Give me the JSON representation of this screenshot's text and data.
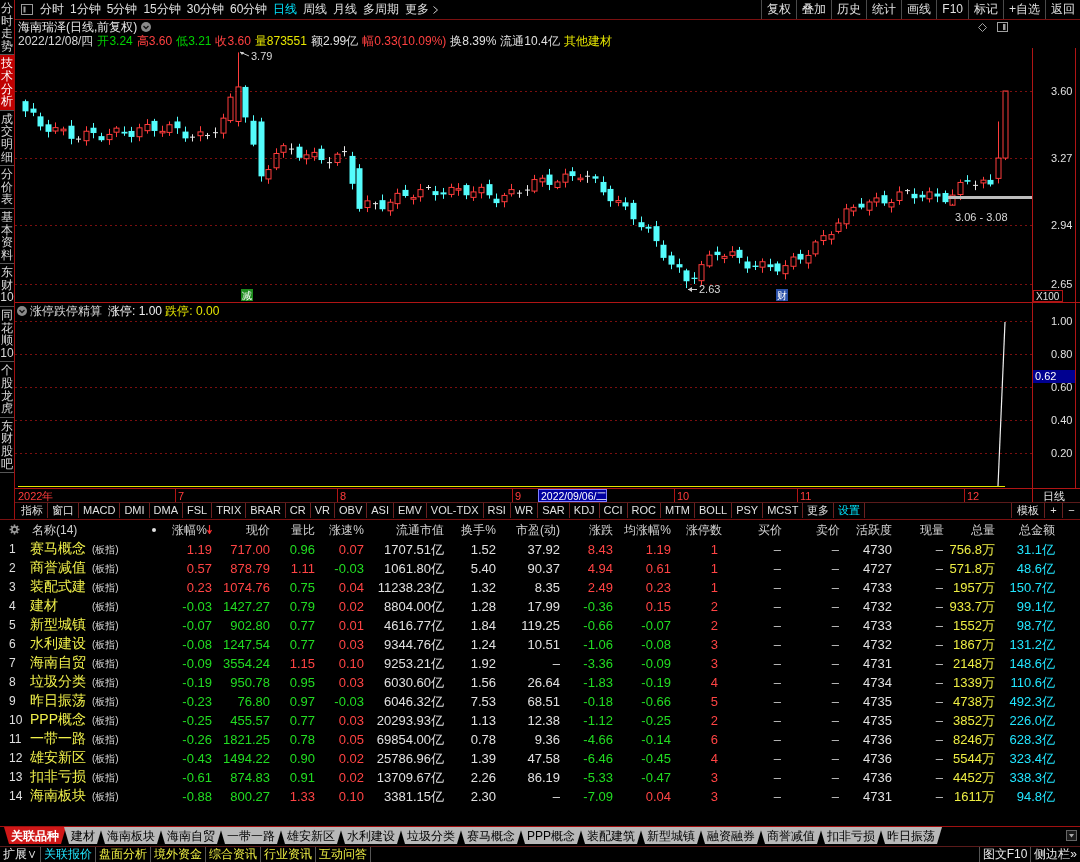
{
  "toolbar": {
    "periods": [
      {
        "label": "分时",
        "kind": "period",
        "selected": false
      },
      {
        "label": "1分钟",
        "kind": "period",
        "selected": false
      },
      {
        "label": "5分钟",
        "kind": "period",
        "selected": false
      },
      {
        "label": "15分钟",
        "kind": "period",
        "selected": false
      },
      {
        "label": "30分钟",
        "kind": "period",
        "selected": false
      },
      {
        "label": "60分钟",
        "kind": "period",
        "selected": false
      },
      {
        "label": "日线",
        "kind": "period",
        "selected": true
      },
      {
        "label": "周线",
        "kind": "period",
        "selected": false
      },
      {
        "label": "月线",
        "kind": "period",
        "selected": false
      },
      {
        "label": "多周期",
        "kind": "period",
        "selected": false
      },
      {
        "label": "更多",
        "kind": "menu",
        "selected": false
      }
    ],
    "actions": [
      "复权",
      "叠加",
      "历史",
      "统计",
      "画线",
      "F10",
      "标记",
      "+自选",
      "返回"
    ]
  },
  "side_tabs": [
    {
      "label": "分时走势",
      "selected": false
    },
    {
      "label": "技术分析",
      "selected": true
    },
    {
      "label": "成交明细",
      "selected": false
    },
    {
      "label": "分价表",
      "selected": false
    },
    {
      "label": "基本资料",
      "selected": false
    },
    {
      "label": "东财10",
      "selected": false
    },
    {
      "label": "同花顺10",
      "selected": false
    },
    {
      "label": "个股龙虎",
      "selected": false
    },
    {
      "label": "东财股吧",
      "selected": false
    }
  ],
  "chart": {
    "title": "海南瑞泽(日线,前复权)",
    "date": "2022/12/08/四",
    "quote": [
      {
        "text": "开3.24",
        "color": "#00d200"
      },
      {
        "text": "高3.60",
        "color": "#ff4040"
      },
      {
        "text": "低3.21",
        "color": "#00d200"
      },
      {
        "text": "收3.60",
        "color": "#ff4040"
      },
      {
        "text": "量873551",
        "color": "#e6e600"
      },
      {
        "text": "额2.99亿",
        "color": "#e0e0e0"
      },
      {
        "text": "幅0.33(10.09%)",
        "color": "#ff4040"
      },
      {
        "text": "换8.39%",
        "color": "#e0e0e0"
      },
      {
        "text": "流通10.4亿",
        "color": "#e0e0e0"
      },
      {
        "text": "其他建材",
        "color": "#e6e600"
      }
    ],
    "price_labels": [
      "3.60",
      "3.27",
      "2.94",
      "2.65"
    ],
    "high_label": "3.79",
    "low_label": "2.63",
    "range_label": "3.06 - 3.08",
    "scale_label": "X100",
    "events": [
      {
        "label": "减",
        "color": "#1e8c1e"
      },
      {
        "label": "财",
        "color": "#2a4fa8"
      }
    ]
  },
  "indicator": {
    "title": "涨停跌停精算",
    "series": [
      {
        "label": "涨停:",
        "value": "1.00",
        "color": "#f0f0f0"
      },
      {
        "label": "跌停:",
        "value": "0.00",
        "color": "#e6e600"
      }
    ],
    "axis_labels": [
      "1.00",
      "0.80",
      "0.60",
      "0.40",
      "0.20"
    ],
    "cursor_value": "0.62"
  },
  "time_axis": {
    "labels": [
      "2022年",
      "7",
      "8",
      "9",
      "10",
      "11",
      "12"
    ],
    "cursor_date": "2022/09/06/二",
    "period": "日线"
  },
  "indicator_tabs": [
    {
      "label": "指标",
      "kind": "tab"
    },
    {
      "label": "窗口",
      "kind": "tab"
    },
    {
      "label": "MACD",
      "kind": "tab"
    },
    {
      "label": "DMI",
      "kind": "tab"
    },
    {
      "label": "DMA",
      "kind": "tab"
    },
    {
      "label": "FSL",
      "kind": "tab"
    },
    {
      "label": "TRIX",
      "kind": "tab"
    },
    {
      "label": "BRAR",
      "kind": "tab"
    },
    {
      "label": "CR",
      "kind": "tab"
    },
    {
      "label": "VR",
      "kind": "tab"
    },
    {
      "label": "OBV",
      "kind": "tab"
    },
    {
      "label": "ASI",
      "kind": "tab"
    },
    {
      "label": "EMV",
      "kind": "tab"
    },
    {
      "label": "VOL-TDX",
      "kind": "tab"
    },
    {
      "label": "RSI",
      "kind": "tab"
    },
    {
      "label": "WR",
      "kind": "tab"
    },
    {
      "label": "SAR",
      "kind": "tab"
    },
    {
      "label": "KDJ",
      "kind": "tab"
    },
    {
      "label": "CCI",
      "kind": "tab"
    },
    {
      "label": "ROC",
      "kind": "tab"
    },
    {
      "label": "MTM",
      "kind": "tab"
    },
    {
      "label": "BOLL",
      "kind": "tab"
    },
    {
      "label": "PSY",
      "kind": "tab"
    },
    {
      "label": "MCST",
      "kind": "tab"
    },
    {
      "label": "更多",
      "kind": "tab"
    },
    {
      "label": "设置",
      "kind": "setting"
    }
  ],
  "indicator_tools": [
    "模板",
    "+",
    "−"
  ],
  "table": {
    "columns": [
      {
        "label": "名称(14)",
        "sorted": false
      },
      {
        "label": "涨幅%",
        "sorted": true
      },
      {
        "label": "现价",
        "sorted": false
      },
      {
        "label": "量比",
        "sorted": false
      },
      {
        "label": "涨速%",
        "sorted": false
      },
      {
        "label": "流通市值",
        "sorted": false
      },
      {
        "label": "换手%",
        "sorted": false
      },
      {
        "label": "市盈(动)",
        "sorted": false
      },
      {
        "label": "涨跌",
        "sorted": false
      },
      {
        "label": "均涨幅%",
        "sorted": false
      },
      {
        "label": "涨停数",
        "sorted": false
      },
      {
        "label": "买价",
        "sorted": false
      },
      {
        "label": "卖价",
        "sorted": false
      },
      {
        "label": "活跃度",
        "sorted": false
      },
      {
        "label": "现量",
        "sorted": false
      },
      {
        "label": "总量",
        "sorted": false
      },
      {
        "label": "总金额",
        "sorted": false
      }
    ],
    "rows": [
      {
        "index": "1",
        "name": "赛马概念",
        "tag": "(板指)",
        "change": {
          "text": "1.19",
          "up": true
        },
        "price": {
          "text": "717.00",
          "up": true
        },
        "volume_ratio": {
          "text": "0.96",
          "up": false
        },
        "speed": {
          "text": "0.07",
          "up": true
        },
        "float_value": "1707.51亿",
        "turnover": "1.52",
        "pe": "37.92",
        "diff": {
          "text": "8.43",
          "up": true
        },
        "avg_change": {
          "text": "1.19",
          "up": true
        },
        "limit_ups": "1",
        "bid": "–",
        "ask": "–",
        "activity": "4730",
        "last_volume": "–",
        "volume": "756.8万",
        "amount": "31.1亿"
      },
      {
        "index": "2",
        "name": "商誉减值",
        "tag": "(板指)",
        "change": {
          "text": "0.57",
          "up": true
        },
        "price": {
          "text": "878.79",
          "up": true
        },
        "volume_ratio": {
          "text": "1.11",
          "up": true
        },
        "speed": {
          "text": "-0.03",
          "up": false
        },
        "float_value": "1061.80亿",
        "turnover": "5.40",
        "pe": "90.37",
        "diff": {
          "text": "4.94",
          "up": true
        },
        "avg_change": {
          "text": "0.61",
          "up": true
        },
        "limit_ups": "1",
        "bid": "–",
        "ask": "–",
        "activity": "4727",
        "last_volume": "–",
        "volume": "571.8万",
        "amount": "48.6亿"
      },
      {
        "index": "3",
        "name": "装配式建",
        "tag": "(板指)",
        "change": {
          "text": "0.23",
          "up": true
        },
        "price": {
          "text": "1074.76",
          "up": true
        },
        "volume_ratio": {
          "text": "0.75",
          "up": false
        },
        "speed": {
          "text": "0.04",
          "up": true
        },
        "float_value": "11238.23亿",
        "turnover": "1.32",
        "pe": "8.35",
        "diff": {
          "text": "2.49",
          "up": true
        },
        "avg_change": {
          "text": "0.23",
          "up": true
        },
        "limit_ups": "1",
        "bid": "–",
        "ask": "–",
        "activity": "4733",
        "last_volume": "–",
        "volume": "1957万",
        "amount": "150.7亿"
      },
      {
        "index": "4",
        "name": "建材",
        "tag": "(板指)",
        "change": {
          "text": "-0.03",
          "up": false
        },
        "price": {
          "text": "1427.27",
          "up": false
        },
        "volume_ratio": {
          "text": "0.79",
          "up": false
        },
        "speed": {
          "text": "0.02",
          "up": true
        },
        "float_value": "8804.00亿",
        "turnover": "1.28",
        "pe": "17.99",
        "diff": {
          "text": "-0.36",
          "up": false
        },
        "avg_change": {
          "text": "0.15",
          "up": true
        },
        "limit_ups": "2",
        "bid": "–",
        "ask": "–",
        "activity": "4732",
        "last_volume": "–",
        "volume": "933.7万",
        "amount": "99.1亿"
      },
      {
        "index": "5",
        "name": "新型城镇",
        "tag": "(板指)",
        "change": {
          "text": "-0.07",
          "up": false
        },
        "price": {
          "text": "902.80",
          "up": false
        },
        "volume_ratio": {
          "text": "0.77",
          "up": false
        },
        "speed": {
          "text": "0.01",
          "up": true
        },
        "float_value": "4616.77亿",
        "turnover": "1.84",
        "pe": "119.25",
        "diff": {
          "text": "-0.66",
          "up": false
        },
        "avg_change": {
          "text": "-0.07",
          "up": false
        },
        "limit_ups": "2",
        "bid": "–",
        "ask": "–",
        "activity": "4733",
        "last_volume": "–",
        "volume": "1552万",
        "amount": "98.7亿"
      },
      {
        "index": "6",
        "name": "水利建设",
        "tag": "(板指)",
        "change": {
          "text": "-0.08",
          "up": false
        },
        "price": {
          "text": "1247.54",
          "up": false
        },
        "volume_ratio": {
          "text": "0.77",
          "up": false
        },
        "speed": {
          "text": "0.03",
          "up": true
        },
        "float_value": "9344.76亿",
        "turnover": "1.24",
        "pe": "10.51",
        "diff": {
          "text": "-1.06",
          "up": false
        },
        "avg_change": {
          "text": "-0.08",
          "up": false
        },
        "limit_ups": "3",
        "bid": "–",
        "ask": "–",
        "activity": "4732",
        "last_volume": "–",
        "volume": "1867万",
        "amount": "131.2亿"
      },
      {
        "index": "7",
        "name": "海南自贸",
        "tag": "(板指)",
        "change": {
          "text": "-0.09",
          "up": false
        },
        "price": {
          "text": "3554.24",
          "up": false
        },
        "volume_ratio": {
          "text": "1.15",
          "up": true
        },
        "speed": {
          "text": "0.10",
          "up": true
        },
        "float_value": "9253.21亿",
        "turnover": "1.92",
        "pe": "–",
        "diff": {
          "text": "-3.36",
          "up": false
        },
        "avg_change": {
          "text": "-0.09",
          "up": false
        },
        "limit_ups": "3",
        "bid": "–",
        "ask": "–",
        "activity": "4731",
        "last_volume": "–",
        "volume": "2148万",
        "amount": "148.6亿"
      },
      {
        "index": "8",
        "name": "垃圾分类",
        "tag": "(板指)",
        "change": {
          "text": "-0.19",
          "up": false
        },
        "price": {
          "text": "950.78",
          "up": false
        },
        "volume_ratio": {
          "text": "0.95",
          "up": false
        },
        "speed": {
          "text": "0.03",
          "up": true
        },
        "float_value": "6030.60亿",
        "turnover": "1.56",
        "pe": "26.64",
        "diff": {
          "text": "-1.83",
          "up": false
        },
        "avg_change": {
          "text": "-0.19",
          "up": false
        },
        "limit_ups": "4",
        "bid": "–",
        "ask": "–",
        "activity": "4734",
        "last_volume": "–",
        "volume": "1339万",
        "amount": "110.6亿"
      },
      {
        "index": "9",
        "name": "昨日振荡",
        "tag": "(板指)",
        "change": {
          "text": "-0.23",
          "up": false
        },
        "price": {
          "text": "76.80",
          "up": false
        },
        "volume_ratio": {
          "text": "0.97",
          "up": false
        },
        "speed": {
          "text": "-0.03",
          "up": false
        },
        "float_value": "6046.32亿",
        "turnover": "7.53",
        "pe": "68.51",
        "diff": {
          "text": "-0.18",
          "up": false
        },
        "avg_change": {
          "text": "-0.66",
          "up": false
        },
        "limit_ups": "5",
        "bid": "–",
        "ask": "–",
        "activity": "4735",
        "last_volume": "–",
        "volume": "4738万",
        "amount": "492.3亿"
      },
      {
        "index": "10",
        "name": "PPP概念",
        "tag": "(板指)",
        "change": {
          "text": "-0.25",
          "up": false
        },
        "price": {
          "text": "455.57",
          "up": false
        },
        "volume_ratio": {
          "text": "0.77",
          "up": false
        },
        "speed": {
          "text": "0.03",
          "up": true
        },
        "float_value": "20293.93亿",
        "turnover": "1.13",
        "pe": "12.38",
        "diff": {
          "text": "-1.12",
          "up": false
        },
        "avg_change": {
          "text": "-0.25",
          "up": false
        },
        "limit_ups": "2",
        "bid": "–",
        "ask": "–",
        "activity": "4735",
        "last_volume": "–",
        "volume": "3852万",
        "amount": "226.0亿"
      },
      {
        "index": "11",
        "name": "一带一路",
        "tag": "(板指)",
        "change": {
          "text": "-0.26",
          "up": false
        },
        "price": {
          "text": "1821.25",
          "up": false
        },
        "volume_ratio": {
          "text": "0.78",
          "up": false
        },
        "speed": {
          "text": "0.05",
          "up": true
        },
        "float_value": "69854.00亿",
        "turnover": "0.78",
        "pe": "9.36",
        "diff": {
          "text": "-4.66",
          "up": false
        },
        "avg_change": {
          "text": "-0.14",
          "up": false
        },
        "limit_ups": "6",
        "bid": "–",
        "ask": "–",
        "activity": "4736",
        "last_volume": "–",
        "volume": "8246万",
        "amount": "628.3亿"
      },
      {
        "index": "12",
        "name": "雄安新区",
        "tag": "(板指)",
        "change": {
          "text": "-0.43",
          "up": false
        },
        "price": {
          "text": "1494.22",
          "up": false
        },
        "volume_ratio": {
          "text": "0.90",
          "up": false
        },
        "speed": {
          "text": "0.02",
          "up": true
        },
        "float_value": "25786.96亿",
        "turnover": "1.39",
        "pe": "47.58",
        "diff": {
          "text": "-6.46",
          "up": false
        },
        "avg_change": {
          "text": "-0.45",
          "up": false
        },
        "limit_ups": "4",
        "bid": "–",
        "ask": "–",
        "activity": "4736",
        "last_volume": "–",
        "volume": "5544万",
        "amount": "323.4亿"
      },
      {
        "index": "13",
        "name": "扣非亏损",
        "tag": "(板指)",
        "change": {
          "text": "-0.61",
          "up": false
        },
        "price": {
          "text": "874.83",
          "up": false
        },
        "volume_ratio": {
          "text": "0.91",
          "up": false
        },
        "speed": {
          "text": "0.02",
          "up": true
        },
        "float_value": "13709.67亿",
        "turnover": "2.26",
        "pe": "86.19",
        "diff": {
          "text": "-5.33",
          "up": false
        },
        "avg_change": {
          "text": "-0.47",
          "up": false
        },
        "limit_ups": "3",
        "bid": "–",
        "ask": "–",
        "activity": "4736",
        "last_volume": "–",
        "volume": "4452万",
        "amount": "338.3亿"
      },
      {
        "index": "14",
        "name": "海南板块",
        "tag": "(板指)",
        "change": {
          "text": "-0.88",
          "up": false
        },
        "price": {
          "text": "800.27",
          "up": false
        },
        "volume_ratio": {
          "text": "1.33",
          "up": true
        },
        "speed": {
          "text": "0.10",
          "up": true
        },
        "float_value": "3381.15亿",
        "turnover": "2.30",
        "pe": "–",
        "diff": {
          "text": "-7.09",
          "up": false
        },
        "avg_change": {
          "text": "0.04",
          "up": true
        },
        "limit_ups": "3",
        "bid": "–",
        "ask": "–",
        "activity": "4731",
        "last_volume": "–",
        "volume": "1611万",
        "amount": "94.8亿"
      }
    ]
  },
  "block_tabs": [
    {
      "label": "关联品种",
      "selected": true
    },
    {
      "label": "建材",
      "selected": false
    },
    {
      "label": "海南板块",
      "selected": false
    },
    {
      "label": "海南自贸",
      "selected": false
    },
    {
      "label": "一带一路",
      "selected": false
    },
    {
      "label": "雄安新区",
      "selected": false
    },
    {
      "label": "水利建设",
      "selected": false
    },
    {
      "label": "垃圾分类",
      "selected": false
    },
    {
      "label": "赛马概念",
      "selected": false
    },
    {
      "label": "PPP概念",
      "selected": false
    },
    {
      "label": "装配建筑",
      "selected": false
    },
    {
      "label": "新型城镇",
      "selected": false
    },
    {
      "label": "融资融券",
      "selected": false
    },
    {
      "label": "商誉减值",
      "selected": false
    },
    {
      "label": "扣非亏损",
      "selected": false
    },
    {
      "label": "昨日振荡",
      "selected": false
    }
  ],
  "footer": {
    "expand": "扩展∨",
    "tabs": [
      {
        "label": "关联报价",
        "selected": true
      },
      {
        "label": "盘面分析",
        "selected": false
      },
      {
        "label": "境外资金",
        "selected": false
      },
      {
        "label": "综合资讯",
        "selected": false
      },
      {
        "label": "行业资讯",
        "selected": false
      },
      {
        "label": "互动问答",
        "selected": false
      }
    ],
    "links": [
      "图文F10",
      "侧边栏»"
    ]
  }
}
